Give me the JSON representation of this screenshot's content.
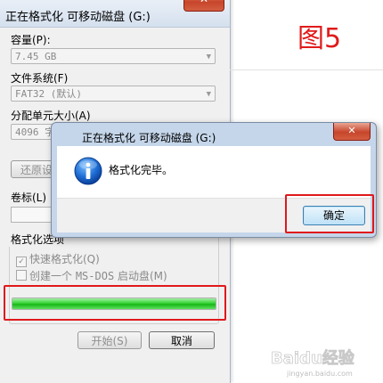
{
  "background_window": {
    "title": "正在格式化 可移动磁盘 (G:)",
    "capacity_label": "容量(P):",
    "capacity_value": "7.45 GB",
    "filesystem_label": "文件系统(F)",
    "filesystem_value": "FAT32 (默认)",
    "allocation_label": "分配单元大小(A)",
    "allocation_value": "4096 字",
    "restore_button": "还原设",
    "volume_label": "卷标(L)",
    "options_group": "格式化选项",
    "quick_format": "快速格式化(Q)",
    "msdos_prefix": "创建一个 ",
    "msdos_mono": "MS-DOS",
    "msdos_suffix": " 启动盘(M)",
    "progress": 1.0,
    "start_button": "开始(S)",
    "cancel_button": "取消"
  },
  "annotation": {
    "text": "图5"
  },
  "dialog": {
    "title": "正在格式化 可移动磁盘 (G:)",
    "message": "格式化完毕。",
    "ok_button": "确定",
    "close_glyph": "✕"
  },
  "watermark": {
    "text": "Baidu经验",
    "sub": "jingyan.baidu.com"
  },
  "colors": {
    "annotation_red": "#e01b1b",
    "progress_green": "#22c522",
    "dialog_frame": "#c5d6ea"
  }
}
